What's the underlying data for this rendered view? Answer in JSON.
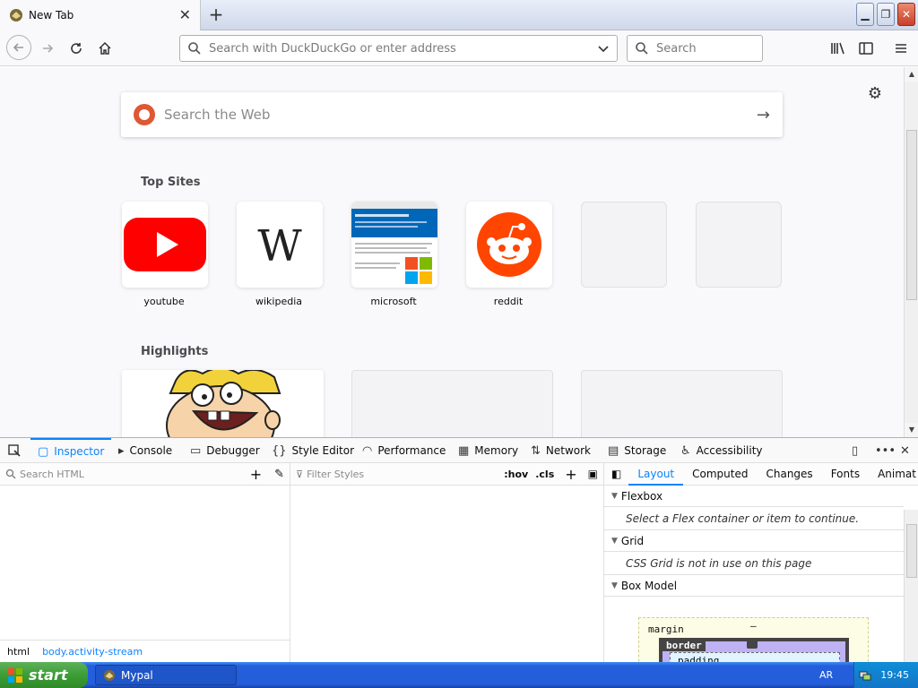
{
  "browser": {
    "tab_title": "New Tab",
    "url_placeholder": "Search with DuckDuckGo or enter address",
    "search_placeholder": "Search"
  },
  "newtab": {
    "web_search_placeholder": "Search the Web",
    "top_sites_heading": "Top Sites",
    "highlights_heading": "Highlights",
    "top_sites": [
      {
        "label": "youtube"
      },
      {
        "label": "wikipedia"
      },
      {
        "label": "microsoft"
      },
      {
        "label": "reddit"
      }
    ]
  },
  "devtools": {
    "tabs": [
      {
        "label": "Inspector"
      },
      {
        "label": "Console"
      },
      {
        "label": "Debugger"
      },
      {
        "label": "Style Editor"
      },
      {
        "label": "Performance"
      },
      {
        "label": "Memory"
      },
      {
        "label": "Network"
      },
      {
        "label": "Storage"
      },
      {
        "label": "Accessibility"
      }
    ],
    "search_html_placeholder": "Search HTML",
    "filter_styles_placeholder": "Filter Styles",
    "hov": ":hov",
    "cls": ".cls",
    "breadcrumbs": [
      "html",
      "body.activity-stream"
    ],
    "right_tabs": [
      {
        "label": "Layout"
      },
      {
        "label": "Computed"
      },
      {
        "label": "Changes"
      },
      {
        "label": "Fonts"
      },
      {
        "label": "Animat"
      }
    ],
    "layout": {
      "flexbox": "Flexbox",
      "flexbox_msg": "Select a Flex container or item to continue.",
      "grid": "Grid",
      "grid_msg": "CSS Grid is not in use on this page",
      "box_model": "Box Model",
      "margin_label": "margin",
      "border_label": "border",
      "padding_label": "padding",
      "dash": "–"
    }
  },
  "taskbar": {
    "start_label": "start",
    "task_label": "Mypal",
    "lang": "AR",
    "clock": "19:45"
  }
}
